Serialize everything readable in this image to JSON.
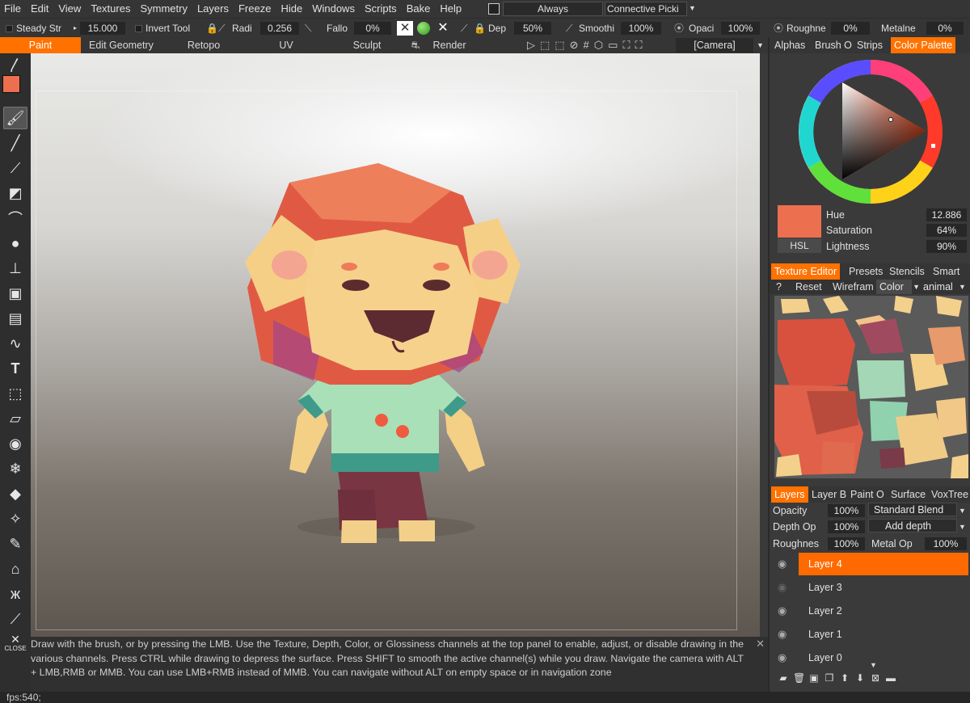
{
  "menu": [
    "File",
    "Edit",
    "View",
    "Textures",
    "Symmetry",
    "Layers",
    "Freeze",
    "Hide",
    "Windows",
    "Scripts",
    "Bake",
    "Help"
  ],
  "menubar_right": {
    "always_label": "Always",
    "connective_label": "Connective Picki"
  },
  "options": {
    "steady_label": "Steady Str",
    "steady_value": "15.000",
    "invert_label": "Invert Tool",
    "radius_label": "Radi",
    "radius_value": "0.256",
    "falloff_label": "Fallo",
    "falloff_value": "0%",
    "depth_label": "Dep",
    "depth_value": "50%",
    "smooth_label": "Smoothi",
    "smooth_value": "100%",
    "opacity_label": "Opaci",
    "opacity_value": "100%",
    "roughness_label": "Roughne",
    "roughness_value": "0%",
    "metalness_label": "Metalne",
    "metalness_value": "0%"
  },
  "rooms": [
    "Paint",
    "Edit Geometry",
    "Retopo",
    "UV",
    "Sculpt",
    "Render"
  ],
  "viewport": {
    "camera_label": "[Camera]"
  },
  "right_tabs_top": [
    "Alphas",
    "Brush O",
    "Strips",
    "Color Palette"
  ],
  "color": {
    "hsl_label": "HSL",
    "hue_label": "Hue",
    "hue_value": "12.886",
    "saturation_label": "Saturation",
    "saturation_value": "64%",
    "lightness_label": "Lightness",
    "lightness_value": "90%",
    "swatch": "#ec6f50"
  },
  "texture_tabs": [
    "Texture Editor",
    "Presets",
    "Stencils",
    "Smart"
  ],
  "texture_toolbar": {
    "help": "?",
    "reset": "Reset",
    "wireframe": "Wirefram",
    "channel": "Color",
    "object": "animal"
  },
  "layer_tabs": [
    "Layers",
    "Layer B",
    "Paint O",
    "Surface",
    "VoxTree"
  ],
  "layer_props": {
    "opacity_label": "Opacity",
    "opacity_value": "100%",
    "blend": "Standard Blend",
    "depth_op_label": "Depth Op",
    "depth_op_value": "100%",
    "add_depth": "Add depth",
    "roughness_label": "Roughnes",
    "roughness_value": "100%",
    "metal_op_label": "Metal Op",
    "metal_op_value": "100%"
  },
  "layers": [
    "Layer 4",
    "Layer 3",
    "Layer 2",
    "Layer 1",
    "Layer 0"
  ],
  "help_text": "Draw with the brush, or by pressing the LMB. Use the Texture, Depth, Color, or Glossiness channels at the top panel to enable, adjust, or disable drawing in the various channels. Press CTRL while drawing to depress the surface. Press SHIFT to smooth the active channel(s) while you draw. Navigate the camera with ALT + LMB,RMB or MMB. You can use LMB+RMB instead of MMB. You can navigate without ALT on empty space or in navigation zone",
  "close_label": "CLOSE",
  "status": "fps:540;"
}
